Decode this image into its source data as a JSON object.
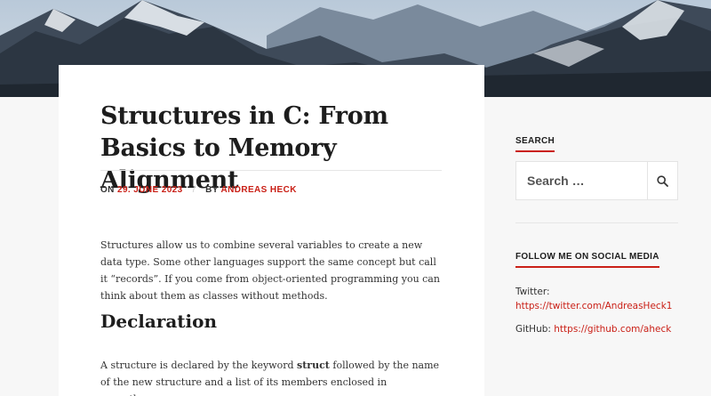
{
  "hero": {
    "icon": "mountain-landscape-image"
  },
  "article": {
    "title": "Structures in C: From Basics to Memory Alignment",
    "meta": {
      "on_label": "ON",
      "date": "29. JUNE 2023",
      "separator": "/",
      "by_label": "BY",
      "author": "ANDREAS HECK"
    },
    "intro": "Structures allow us to combine several variables to create a new data type. Some other languages support the same concept but call it “records”. If you come from object-oriented programming you can think about them as classes without methods.",
    "section_heading": "Declaration",
    "para2_before": "A structure is declared by the keyword ",
    "para2_keyword": "struct",
    "para2_after": " followed by the name of the new structure and a list of its members enclosed in parentheses:"
  },
  "sidebar": {
    "search_heading": "SEARCH",
    "search_placeholder": "Search …",
    "search_icon": "search-icon",
    "social_heading": "FOLLOW ME ON SOCIAL MEDIA",
    "twitter_label": "Twitter:",
    "twitter_url": "https://twitter.com/AndreasHeck1",
    "github_label": "GitHub:",
    "github_url": "https://github.com/aheck"
  },
  "colors": {
    "accent": "#ca2017",
    "text": "#1d1d1d",
    "background": "#f7f7f7"
  }
}
